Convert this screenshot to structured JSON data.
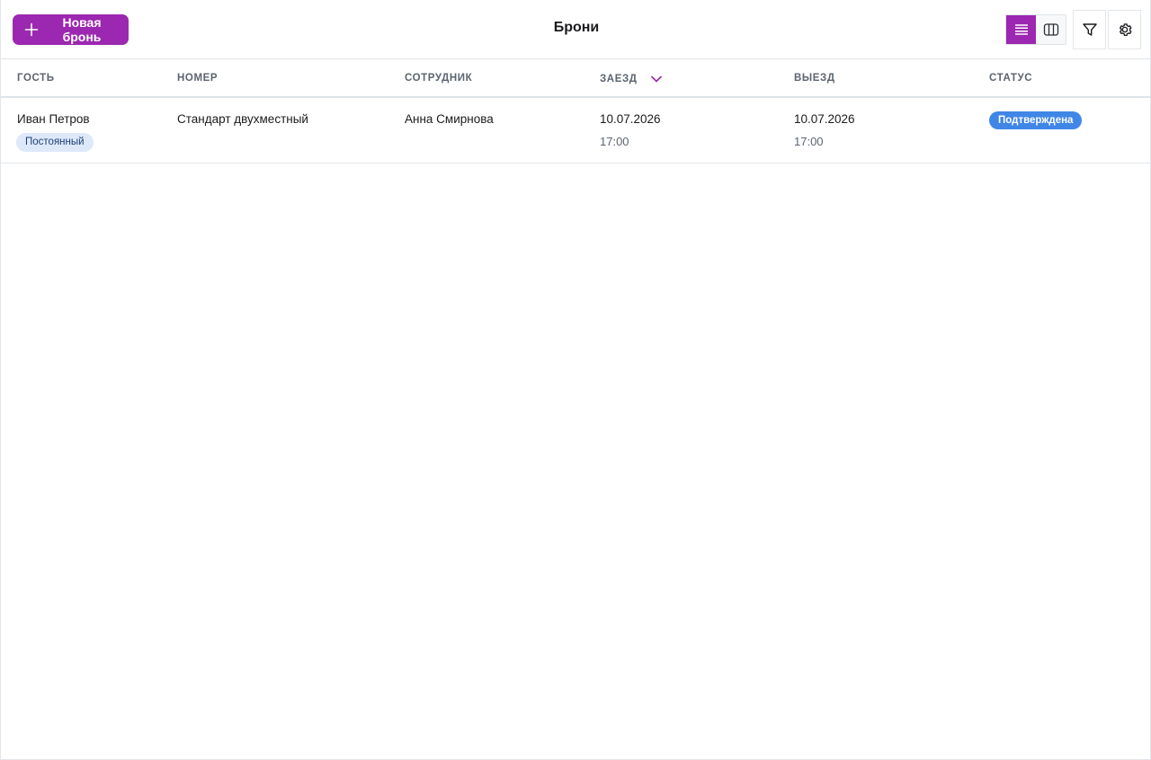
{
  "header": {
    "new_button_label": "Новая бронь",
    "title": "Брони"
  },
  "table": {
    "columns": [
      "Гость",
      "Номер",
      "Сотрудник",
      "Заезд",
      "Выезд",
      "Статус"
    ],
    "sorted_column": "Заезд",
    "rows": [
      {
        "guest": "Иван Петров",
        "guest_tag": "Постоянный",
        "room": "Стандарт двухместный",
        "employee": "Анна Смирнова",
        "checkin_date": "10.07.2026",
        "checkin_time": "17:00",
        "checkout_date": "10.07.2026",
        "checkout_time": "17:00",
        "status": "Подтверждена"
      }
    ]
  },
  "icons": {
    "new_button": "plus-icon",
    "view_list": "list-view-icon",
    "view_columns": "columns-view-icon",
    "filter": "filter-icon",
    "settings": "gear-icon",
    "sort": "chevron-down-icon"
  },
  "colors": {
    "accent": "#9c27b0",
    "status_confirmed": "#3f86e6",
    "tag_bg": "#dde9fb"
  }
}
